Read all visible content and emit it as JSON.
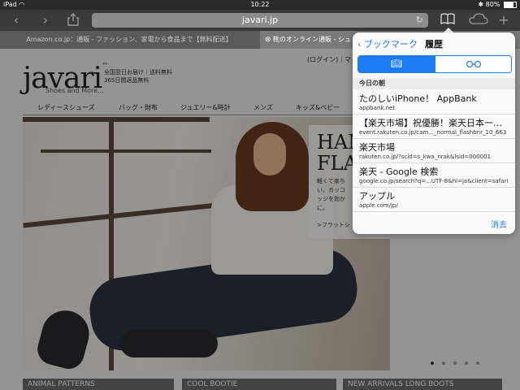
{
  "status_bar": {
    "device": "iPad",
    "time": "10:22",
    "battery": "80%",
    "battery_level": 0.8
  },
  "toolbar": {
    "address": "javari.jp"
  },
  "tabs": [
    {
      "label": "Amazon.co.jp：通販 - ファッション、家電から食品まで【無料配送】"
    },
    {
      "label": "靴のオンライン通販 - シュ"
    }
  ],
  "page": {
    "logo": "javari",
    "logo_sub": "Shoes and More...",
    "promo": [
      "全国翌日お届け｜送料無料",
      "365日間返品無料"
    ],
    "login": "(ログイン)｜マイ",
    "nav": [
      "レディースシューズ",
      "バッグ・財布",
      "ジュエリー&時計",
      "メンズ",
      "キッズ&ベビー"
    ],
    "hero_title": [
      "HAN",
      "FLA"
    ],
    "hero_desc": [
      "軽くて楽ち",
      "い。カッコ",
      "ッジを効か",
      "に。"
    ],
    "hero_link": ">フラットシ",
    "banners": [
      "ANIMAL PATTERNS",
      "COOL BOOTIE",
      "NEW ARRIVALS LONG BOOTS"
    ]
  },
  "popover": {
    "back_label": "ブックマーク",
    "title": "履歴",
    "section": "今日の朝",
    "items": [
      {
        "title": "たのしいiPhone！ AppBank",
        "url": "appbank.net"
      },
      {
        "title": "【楽天市場】祝優勝！楽天日本一…",
        "url": "event.rakuten.co.jp/cam..._normal_flashbnr_10_663"
      },
      {
        "title": "楽天市場",
        "url": "rakuten.co.jp/?scid=s_kwa_nrak&lsid=000001"
      },
      {
        "title": "楽天 - Google 検索",
        "url": "google.co.jp/search?q=...UTF-8&hl=ja&client=safari"
      },
      {
        "title": "アップル",
        "url": "apple.com/jp/"
      }
    ],
    "edit_label": "消去"
  },
  "icons": [
    "wifi-icon",
    "back-icon",
    "forward-icon",
    "share-icon",
    "reload-icon",
    "bookmarks-icon",
    "cloud-icon",
    "plus-icon",
    "bluetooth-icon",
    "battery-icon",
    "book-icon",
    "glasses-icon",
    "chevron-left-icon",
    "close-icon"
  ]
}
